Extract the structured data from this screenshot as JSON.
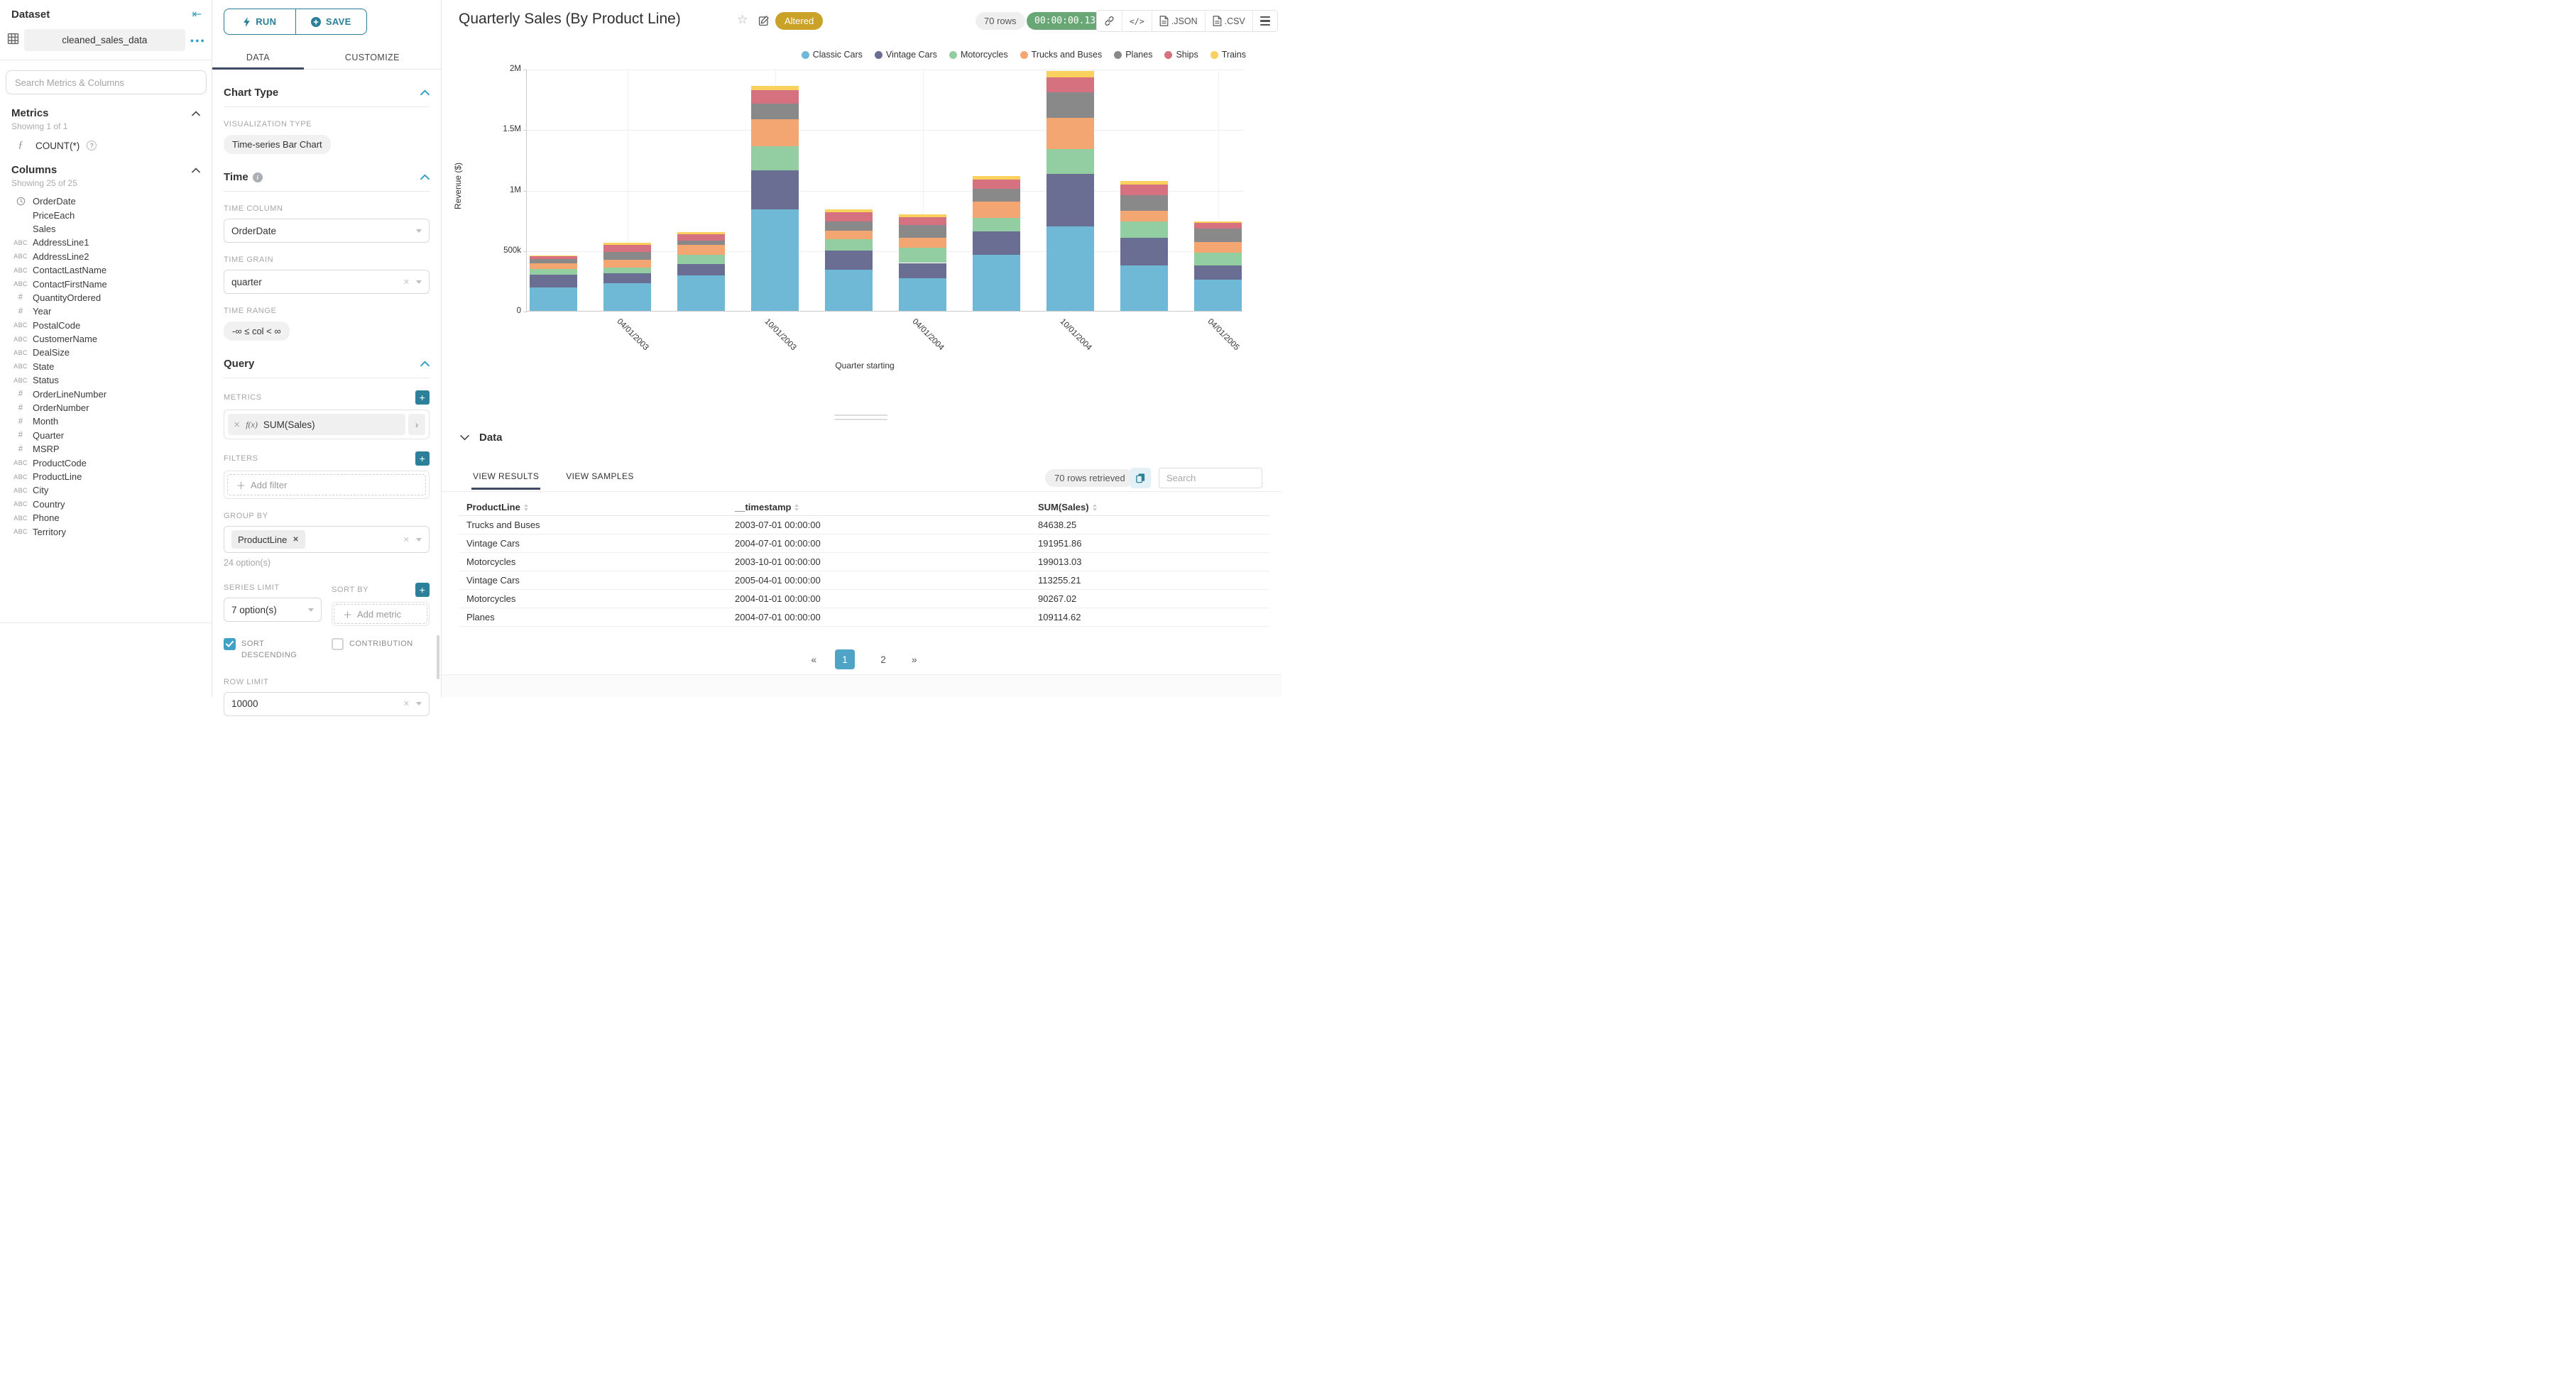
{
  "sidebar": {
    "title": "Dataset",
    "dataset_name": "cleaned_sales_data",
    "search_placeholder": "Search Metrics & Columns",
    "metrics": {
      "title": "Metrics",
      "showing": "Showing 1 of 1",
      "items": [
        {
          "icon": "function-icon",
          "label": "COUNT(*)"
        }
      ]
    },
    "columns": {
      "title": "Columns",
      "showing": "Showing 25 of 25",
      "items": [
        {
          "type": "time",
          "label": "OrderDate"
        },
        {
          "type": "none",
          "label": "PriceEach"
        },
        {
          "type": "none",
          "label": "Sales"
        },
        {
          "type": "text",
          "label": "AddressLine1"
        },
        {
          "type": "text",
          "label": "AddressLine2"
        },
        {
          "type": "text",
          "label": "ContactLastName"
        },
        {
          "type": "text",
          "label": "ContactFirstName"
        },
        {
          "type": "num",
          "label": "QuantityOrdered"
        },
        {
          "type": "num",
          "label": "Year"
        },
        {
          "type": "text",
          "label": "PostalCode"
        },
        {
          "type": "text",
          "label": "CustomerName"
        },
        {
          "type": "text",
          "label": "DealSize"
        },
        {
          "type": "text",
          "label": "State"
        },
        {
          "type": "text",
          "label": "Status"
        },
        {
          "type": "num",
          "label": "OrderLineNumber"
        },
        {
          "type": "num",
          "label": "OrderNumber"
        },
        {
          "type": "num",
          "label": "Month"
        },
        {
          "type": "num",
          "label": "Quarter"
        },
        {
          "type": "num",
          "label": "MSRP"
        },
        {
          "type": "text",
          "label": "ProductCode"
        },
        {
          "type": "text",
          "label": "ProductLine"
        },
        {
          "type": "text",
          "label": "City"
        },
        {
          "type": "text",
          "label": "Country"
        },
        {
          "type": "text",
          "label": "Phone"
        },
        {
          "type": "text",
          "label": "Territory"
        }
      ]
    }
  },
  "controls": {
    "run_label": "RUN",
    "save_label": "SAVE",
    "tabs": [
      "DATA",
      "CUSTOMIZE"
    ],
    "chart_type": {
      "title": "Chart Type",
      "viz_label": "VISUALIZATION TYPE",
      "viz_value": "Time-series Bar Chart"
    },
    "time": {
      "title": "Time",
      "column_label": "TIME COLUMN",
      "column_value": "OrderDate",
      "grain_label": "TIME GRAIN",
      "grain_value": "quarter",
      "range_label": "TIME RANGE",
      "range_value": "-∞ ≤ col < ∞"
    },
    "query": {
      "title": "Query",
      "metrics_label": "METRICS",
      "metric_fx": "f(x)",
      "metric_value": "SUM(Sales)",
      "filters_label": "FILTERS",
      "add_filter": "Add filter",
      "group_by_label": "GROUP BY",
      "group_by_value": "ProductLine",
      "group_by_options": "24 option(s)",
      "series_limit_label": "SERIES LIMIT",
      "series_limit_value": "7 option(s)",
      "sort_by_label": "SORT BY",
      "add_metric": "Add metric",
      "sort_descending_label": "SORT DESCENDING",
      "contribution_label": "CONTRIBUTION",
      "row_limit_label": "ROW LIMIT",
      "row_limit_value": "10000"
    }
  },
  "header": {
    "title": "Quarterly Sales (By Product Line)",
    "altered_badge": "Altered",
    "rows_pill": "70 rows",
    "timer": "00:00:00.13",
    "code_icon_text": "</>",
    "export_json": ".JSON",
    "export_csv": ".CSV"
  },
  "chart_data": {
    "type": "bar",
    "stacked": true,
    "title": "Quarterly Sales (By Product Line)",
    "xlabel": "Quarter starting",
    "ylabel": "Revenue ($)",
    "ylim": [
      0,
      2000000
    ],
    "yticks": [
      0,
      500000,
      1000000,
      1500000,
      2000000
    ],
    "ytick_labels": [
      "0",
      "500k",
      "1M",
      "1.5M",
      "2M"
    ],
    "grid": true,
    "legend_position": "top-right",
    "categories": [
      "01/01/2003",
      "04/01/2003",
      "07/01/2003",
      "10/01/2003",
      "01/01/2004",
      "04/01/2004",
      "07/01/2004",
      "10/01/2004",
      "01/01/2005",
      "04/01/2005"
    ],
    "xtick_indexes": [
      1,
      3,
      5,
      7,
      9
    ],
    "xtick_labels": [
      "04/01/2003",
      "10/01/2003",
      "04/01/2004",
      "10/01/2004",
      "04/01/2005"
    ],
    "series": [
      {
        "name": "Classic Cars",
        "color": "#6FB9D7",
        "values": [
          195000,
          226000,
          292000,
          838000,
          338000,
          269000,
          463000,
          700000,
          373000,
          261000
        ]
      },
      {
        "name": "Vintage Cars",
        "color": "#696E92",
        "values": [
          107000,
          86000,
          93000,
          324000,
          162000,
          127000,
          191951.86,
          430000,
          231000,
          113255.21
        ]
      },
      {
        "name": "Motorcycles",
        "color": "#93CEA2",
        "values": [
          42000,
          48000,
          76000,
          199013.03,
          90267.02,
          126000,
          112000,
          205000,
          135000,
          104000
        ]
      },
      {
        "name": "Trucks and Buses",
        "color": "#F3A671",
        "values": [
          48000,
          63000,
          84638.25,
          221000,
          72000,
          82000,
          134000,
          260000,
          89000,
          90000
        ]
      },
      {
        "name": "Planes",
        "color": "#898989",
        "values": [
          38000,
          62000,
          38000,
          130000,
          78000,
          105000,
          109114.62,
          210000,
          127000,
          112000
        ]
      },
      {
        "name": "Ships",
        "color": "#D6717F",
        "values": [
          20000,
          58000,
          52000,
          110000,
          78000,
          67000,
          75000,
          125000,
          90000,
          45000
        ]
      },
      {
        "name": "Trains",
        "color": "#F9D15C",
        "values": [
          6000,
          18000,
          17000,
          39000,
          19000,
          23000,
          30000,
          55000,
          30000,
          15000
        ]
      }
    ]
  },
  "data_panel": {
    "title": "Data",
    "tabs": [
      "VIEW RESULTS",
      "VIEW SAMPLES"
    ],
    "rows_retrieved": "70 rows retrieved",
    "search_placeholder": "Search",
    "columns": [
      "ProductLine",
      "__timestamp",
      "SUM(Sales)"
    ],
    "rows": [
      [
        "Trucks and Buses",
        "2003-07-01 00:00:00",
        "84638.25"
      ],
      [
        "Vintage Cars",
        "2004-07-01 00:00:00",
        "191951.86"
      ],
      [
        "Motorcycles",
        "2003-10-01 00:00:00",
        "199013.03"
      ],
      [
        "Vintage Cars",
        "2005-04-01 00:00:00",
        "113255.21"
      ],
      [
        "Motorcycles",
        "2004-01-01 00:00:00",
        "90267.02"
      ],
      [
        "Planes",
        "2004-07-01 00:00:00",
        "109114.62"
      ]
    ],
    "pagination": {
      "prev": "«",
      "pages": [
        "1",
        "2"
      ],
      "active": "1",
      "next": "»"
    }
  }
}
